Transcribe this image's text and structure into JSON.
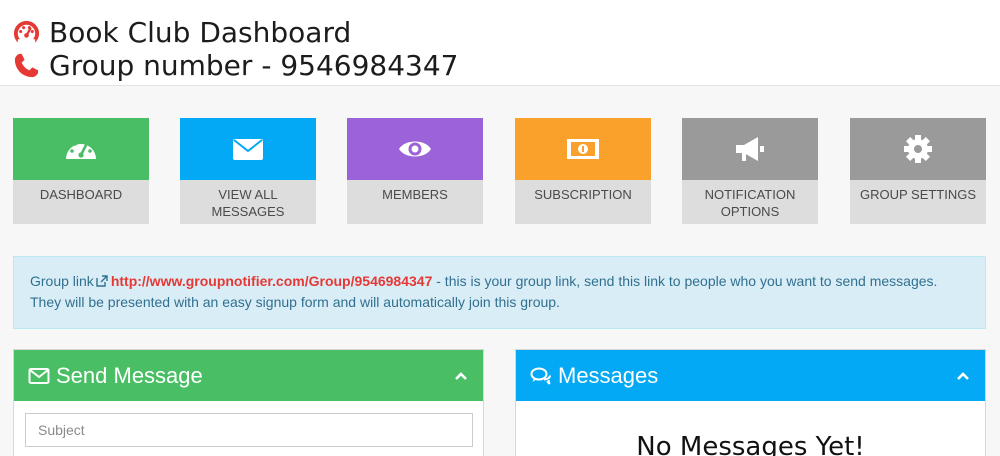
{
  "header": {
    "title": "Book Club Dashboard",
    "title_icon": "dashboard-gauge-icon",
    "group_line": "Group number - 9546984347",
    "group_icon": "phone-icon",
    "icon_color": "#e53935"
  },
  "tiles": [
    {
      "label": "DASHBOARD",
      "icon": "dashboard-icon",
      "color": "#49be64"
    },
    {
      "label": "VIEW ALL MESSAGES",
      "icon": "envelope-icon",
      "color": "#03a9f4"
    },
    {
      "label": "MEMBERS",
      "icon": "eye-icon",
      "color": "#9c62d8"
    },
    {
      "label": "SUBSCRIPTION",
      "icon": "money-icon",
      "color": "#f9a12b"
    },
    {
      "label": "NOTIFICATION OPTIONS",
      "icon": "bullhorn-icon",
      "color": "#9a9a9a"
    },
    {
      "label": "GROUP SETTINGS",
      "icon": "gear-icon",
      "color": "#9a9a9a"
    }
  ],
  "notice": {
    "prefix": "Group link",
    "link": "http://www.groupnotifier.com/Group/9546984347",
    "suffix": " - this is your group link, send this link to people who you want to send messages. They will be presented with an easy signup form and will automatically join this group."
  },
  "send_panel": {
    "title": "Send Message",
    "color": "#49be64",
    "subject_placeholder": "Subject"
  },
  "messages_panel": {
    "title": "Messages",
    "color": "#03a9f4",
    "empty_text": "No Messages Yet!"
  }
}
